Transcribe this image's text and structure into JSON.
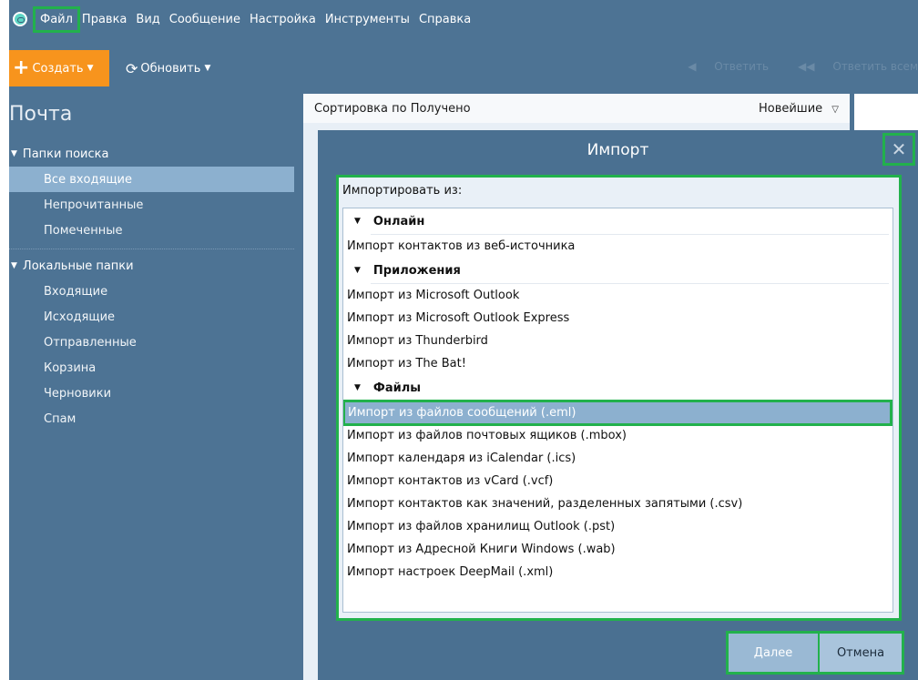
{
  "menu": {
    "items": [
      {
        "label": "Файл"
      },
      {
        "label": "Правка"
      },
      {
        "label": "Вид"
      },
      {
        "label": "Сообщение"
      },
      {
        "label": "Настройка"
      },
      {
        "label": "Инструменты"
      },
      {
        "label": "Справка"
      }
    ]
  },
  "toolbar": {
    "create_label": "Создать",
    "refresh_label": "Обновить",
    "reply_label": "Ответить",
    "reply_all_label": "Ответить всем"
  },
  "sidebar": {
    "title": "Почта",
    "search_group": {
      "label": "Папки поиска",
      "items": [
        {
          "label": "Все входящие"
        },
        {
          "label": "Непрочитанные"
        },
        {
          "label": "Помеченные"
        }
      ]
    },
    "local_group": {
      "label": "Локальные папки",
      "items": [
        {
          "label": "Входящие"
        },
        {
          "label": "Исходящие"
        },
        {
          "label": "Отправленные"
        },
        {
          "label": "Корзина"
        },
        {
          "label": "Черновики"
        },
        {
          "label": "Спам"
        }
      ]
    }
  },
  "messages": {
    "sort_label": "Сортировка по Получено",
    "order_label": "Новейшие"
  },
  "dialog": {
    "title": "Импорт",
    "import_from_label": "Импортировать из:",
    "online": {
      "label": "Онлайн",
      "items": [
        {
          "label": "Импорт контактов из веб-источника"
        }
      ]
    },
    "apps": {
      "label": "Приложения",
      "items": [
        {
          "label": "Импорт из Microsoft Outlook"
        },
        {
          "label": "Импорт из Microsoft Outlook Express"
        },
        {
          "label": "Импорт из Thunderbird"
        },
        {
          "label": "Импорт из The Bat!"
        }
      ]
    },
    "files": {
      "label": "Файлы",
      "items": [
        {
          "label": "Импорт из файлов сообщений (.eml)"
        },
        {
          "label": "Импорт из файлов почтовых ящиков (.mbox)"
        },
        {
          "label": "Импорт календаря из iCalendar (.ics)"
        },
        {
          "label": "Импорт контактов из vCard (.vcf)"
        },
        {
          "label": "Импорт контактов как значений, разделенных запятыми (.csv)"
        },
        {
          "label": "Импорт из файлов хранилищ Outlook (.pst)"
        },
        {
          "label": "Импорт из Адресной Книги Windows (.wab)"
        },
        {
          "label": "Импорт настроек DeepMail (.xml)"
        }
      ]
    },
    "next_label": "Далее",
    "cancel_label": "Отмена"
  },
  "colors": {
    "app_bg": "#4d7394",
    "accent_orange": "#f7941d",
    "selection": "#8cb0cf",
    "highlight_green": "#22b14c"
  }
}
